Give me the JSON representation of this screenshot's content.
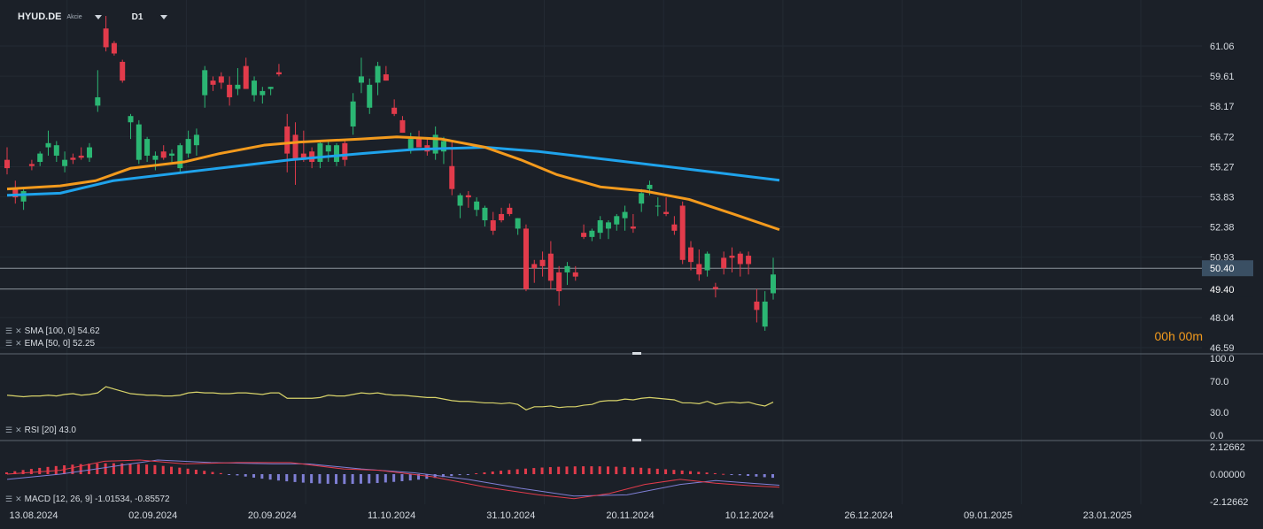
{
  "header": {
    "symbol": "HYUD.DE",
    "instrument_type": "Akcie",
    "timeframe": "D1"
  },
  "price_axis": [
    "61.06",
    "59.61",
    "58.17",
    "56.72",
    "55.27",
    "53.83",
    "52.38",
    "50.93",
    "48.04",
    "46.59"
  ],
  "price_badges": {
    "current": "50.40",
    "line2": "49.40"
  },
  "countdown": "00h 00m",
  "rsi_axis": [
    "100.0",
    "70.0",
    "30.0",
    "0.0"
  ],
  "macd_axis": [
    "2.12662",
    "0.00000",
    "-2.12662"
  ],
  "date_axis": [
    "13.08.2024",
    "02.09.2024",
    "20.09.2024",
    "11.10.2024",
    "31.10.2024",
    "20.11.2024",
    "10.12.2024",
    "26.12.2024",
    "09.01.2025",
    "23.01.2025"
  ],
  "indicators": {
    "sma": "SMA [100, 0]  54.62",
    "ema": "EMA [50, 0]  52.25",
    "rsi": "RSI [20]  43.0",
    "macd": "MACD [12, 26, 9]  -1.01534,  -0.85572"
  },
  "colors": {
    "up": "#2bb673",
    "down": "#e23b4b",
    "sma": "#1fa3ec",
    "ema": "#f39a1d",
    "rsi": "#d8d36a",
    "macd": "#e23b4b",
    "signal": "#7f7fd5"
  },
  "chart_data": {
    "type": "candlestick",
    "x_range": [
      "13.08.2024",
      "23.01.2025"
    ],
    "y_range": [
      46.59,
      61.06
    ],
    "candles": [
      [
        55.6,
        56.2,
        54.9,
        55.2
      ],
      [
        54.2,
        54.6,
        53.5,
        53.8
      ],
      [
        53.6,
        54.3,
        53.2,
        54.1
      ],
      [
        55.4,
        55.6,
        55.1,
        55.3
      ],
      [
        55.5,
        56.0,
        55.3,
        55.9
      ],
      [
        56.2,
        57.0,
        55.8,
        56.4
      ],
      [
        55.8,
        56.5,
        55.5,
        56.3
      ],
      [
        55.3,
        56.0,
        55.0,
        55.6
      ],
      [
        55.7,
        55.9,
        55.4,
        55.6
      ],
      [
        55.8,
        56.2,
        55.6,
        55.7
      ],
      [
        55.7,
        56.4,
        55.5,
        56.2
      ],
      [
        58.2,
        59.9,
        57.9,
        58.6
      ],
      [
        61.9,
        62.5,
        60.8,
        61.0
      ],
      [
        61.2,
        61.3,
        60.6,
        60.7
      ],
      [
        60.3,
        60.4,
        59.3,
        59.4
      ],
      [
        57.4,
        57.8,
        56.6,
        57.7
      ],
      [
        55.6,
        57.5,
        55.4,
        57.3
      ],
      [
        55.8,
        56.7,
        55.5,
        56.6
      ],
      [
        55.6,
        56.0,
        55.1,
        55.8
      ],
      [
        56.0,
        56.3,
        55.6,
        55.7
      ],
      [
        55.8,
        56.1,
        55.5,
        55.9
      ],
      [
        55.2,
        56.4,
        55.0,
        56.3
      ],
      [
        55.9,
        57.0,
        55.7,
        56.6
      ],
      [
        56.3,
        57.1,
        55.8,
        56.8
      ],
      [
        58.7,
        60.1,
        58.1,
        59.9
      ],
      [
        59.4,
        59.6,
        58.9,
        59.2
      ],
      [
        59.6,
        59.8,
        59.0,
        59.3
      ],
      [
        59.2,
        59.6,
        58.2,
        58.6
      ],
      [
        59.0,
        60.0,
        58.7,
        59.2
      ],
      [
        60.1,
        60.5,
        59.0,
        59.0
      ],
      [
        58.7,
        59.6,
        58.4,
        59.4
      ],
      [
        58.7,
        59.1,
        58.3,
        58.9
      ],
      [
        59.0,
        59.1,
        58.7,
        59.1
      ],
      [
        59.8,
        60.2,
        59.6,
        59.7
      ],
      [
        57.2,
        57.8,
        55.0,
        55.9
      ],
      [
        56.8,
        57.4,
        54.4,
        55.6
      ],
      [
        55.9,
        57.0,
        55.5,
        55.6
      ],
      [
        56.0,
        56.2,
        55.2,
        55.5
      ],
      [
        55.5,
        56.5,
        55.2,
        56.4
      ],
      [
        56.0,
        56.5,
        55.5,
        56.3
      ],
      [
        55.5,
        56.4,
        55.3,
        56.3
      ],
      [
        56.4,
        56.5,
        55.3,
        55.6
      ],
      [
        57.2,
        58.8,
        56.8,
        58.4
      ],
      [
        59.3,
        60.5,
        58.8,
        59.6
      ],
      [
        58.1,
        59.5,
        57.8,
        59.2
      ],
      [
        59.3,
        60.3,
        58.7,
        60.1
      ],
      [
        59.7,
        60.1,
        59.4,
        59.4
      ],
      [
        58.1,
        58.5,
        57.7,
        57.8
      ],
      [
        57.5,
        57.7,
        56.9,
        56.9
      ],
      [
        56.1,
        56.9,
        55.9,
        56.6
      ],
      [
        56.6,
        57.0,
        56.3,
        56.2
      ],
      [
        56.3,
        56.6,
        55.8,
        56.0
      ],
      [
        55.9,
        57.2,
        55.6,
        56.8
      ],
      [
        56.0,
        56.7,
        55.4,
        56.5
      ],
      [
        55.3,
        56.5,
        53.9,
        54.2
      ],
      [
        53.4,
        54.0,
        52.8,
        53.9
      ],
      [
        53.9,
        54.1,
        53.3,
        53.8
      ],
      [
        53.2,
        53.8,
        52.9,
        53.6
      ],
      [
        52.7,
        53.4,
        52.4,
        53.3
      ],
      [
        52.7,
        53.1,
        52.0,
        52.2
      ],
      [
        53.0,
        53.3,
        52.6,
        52.7
      ],
      [
        53.3,
        53.5,
        52.9,
        53.0
      ],
      [
        52.3,
        52.8,
        52.0,
        52.8
      ],
      [
        52.3,
        52.5,
        49.3,
        49.4
      ],
      [
        50.6,
        50.8,
        49.7,
        50.4
      ],
      [
        50.8,
        51.2,
        50.0,
        50.5
      ],
      [
        51.1,
        51.7,
        49.4,
        49.8
      ],
      [
        50.2,
        50.5,
        48.6,
        49.3
      ],
      [
        50.2,
        50.7,
        49.6,
        50.5
      ],
      [
        50.2,
        50.5,
        49.8,
        50.0
      ],
      [
        52.1,
        52.5,
        51.8,
        51.9
      ],
      [
        51.9,
        52.3,
        51.7,
        52.2
      ],
      [
        52.1,
        52.9,
        51.8,
        52.7
      ],
      [
        52.3,
        52.7,
        51.8,
        52.6
      ],
      [
        52.5,
        53.0,
        52.2,
        52.9
      ],
      [
        52.8,
        53.4,
        52.2,
        53.1
      ],
      [
        52.4,
        53.0,
        52.1,
        52.3
      ],
      [
        53.5,
        54.2,
        53.1,
        54.0
      ],
      [
        54.2,
        54.6,
        53.9,
        54.4
      ],
      [
        53.4,
        53.8,
        52.9,
        53.4
      ],
      [
        53.1,
        53.8,
        52.9,
        53.0
      ],
      [
        52.5,
        52.9,
        52.0,
        52.2
      ],
      [
        53.4,
        53.6,
        50.6,
        50.8
      ],
      [
        51.4,
        51.7,
        50.3,
        50.7
      ],
      [
        50.6,
        51.3,
        49.8,
        50.1
      ],
      [
        50.3,
        51.2,
        50.0,
        51.1
      ],
      [
        49.5,
        49.7,
        49.0,
        49.4
      ],
      [
        50.9,
        51.2,
        50.1,
        50.4
      ],
      [
        51.0,
        51.4,
        50.2,
        50.9
      ],
      [
        51.1,
        51.2,
        50.0,
        50.6
      ],
      [
        51.0,
        51.2,
        50.1,
        50.6
      ],
      [
        48.8,
        49.4,
        47.8,
        48.4
      ],
      [
        47.6,
        49.3,
        47.4,
        48.8
      ],
      [
        49.2,
        50.9,
        48.9,
        50.1
      ]
    ],
    "sma_100": {
      "start": 54.1,
      "end": 54.62
    },
    "ema_50": {
      "start": 54.5,
      "end": 52.25
    },
    "rsi": {
      "range": [
        0,
        100
      ],
      "last": 43.0
    },
    "macd": {
      "range": [
        -2.12662,
        2.12662
      ],
      "macd": -1.01534,
      "signal": -0.85572
    }
  }
}
